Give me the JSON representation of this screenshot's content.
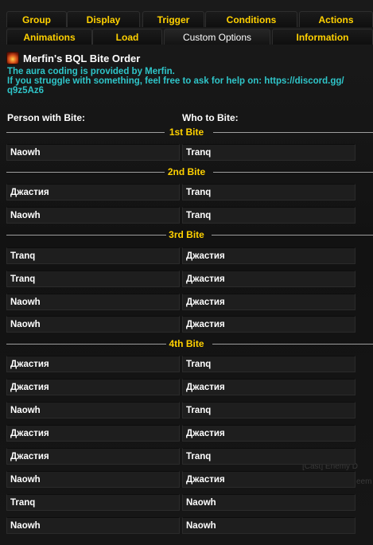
{
  "tabs_row1": [
    "Group",
    "Display",
    "Trigger",
    "Conditions",
    "Actions"
  ],
  "tabs_row2": [
    "Animations",
    "Load",
    "Custom Options",
    "Information"
  ],
  "aura": {
    "title": "Merfin's BQL Bite Order",
    "desc_line1": "The aura coding is provided by Merfin.",
    "desc_line2": "If you struggle with something, feel free to ask for help on: https://discord.gg/",
    "desc_line3": "q9z5Az6"
  },
  "columns": {
    "left": "Person with Bite:",
    "right": "Who to Bite:"
  },
  "sections": [
    {
      "label": "1st Bite",
      "rows": [
        [
          "Naowh",
          "Tranq"
        ]
      ]
    },
    {
      "label": "2nd Bite",
      "rows": [
        [
          "Джастия",
          "Tranq"
        ],
        [
          "Naowh",
          "Tranq"
        ]
      ]
    },
    {
      "label": "3rd Bite",
      "rows": [
        [
          "Tranq",
          "Джастия"
        ],
        [
          "Tranq",
          "Джастия"
        ],
        [
          "Naowh",
          "Джастия"
        ],
        [
          "Naowh",
          "Джастия"
        ]
      ]
    },
    {
      "label": "4th Bite",
      "rows": [
        [
          "Джастия",
          "Tranq"
        ],
        [
          "Джастия",
          "Джастия"
        ],
        [
          "Naowh",
          "Tranq"
        ],
        [
          "Джастия",
          "Джастия"
        ],
        [
          "Джастия",
          "Tranq"
        ],
        [
          "Naowh",
          "Джастия"
        ],
        [
          "Tranq",
          "Naowh"
        ],
        [
          "Naowh",
          "Naowh"
        ]
      ]
    }
  ],
  "background_text": [
    "[Cast] Enemy D",
    "eem"
  ]
}
